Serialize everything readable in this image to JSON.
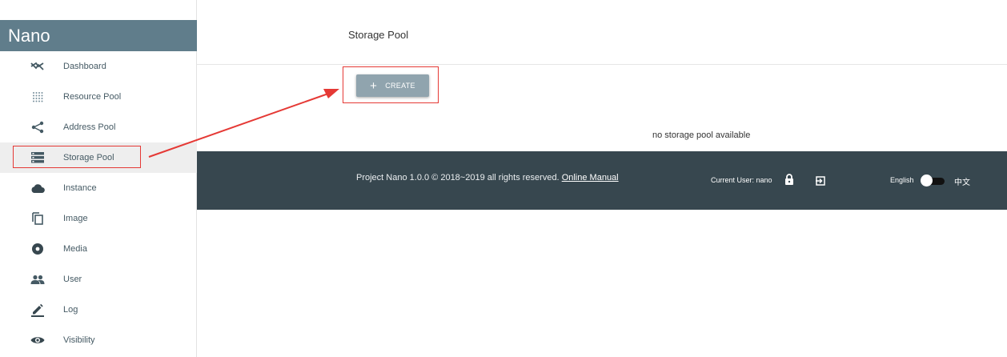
{
  "app": {
    "brand": "Nano"
  },
  "sidebar": {
    "items": [
      {
        "label": "Dashboard",
        "icon": "trending-down-icon"
      },
      {
        "label": "Resource Pool",
        "icon": "dots-grid-icon"
      },
      {
        "label": "Address Pool",
        "icon": "share-icon"
      },
      {
        "label": "Storage Pool",
        "icon": "storage-icon",
        "active": true
      },
      {
        "label": "Instance",
        "icon": "cloud-icon"
      },
      {
        "label": "Image",
        "icon": "copy-icon"
      },
      {
        "label": "Media",
        "icon": "disc-icon"
      },
      {
        "label": "User",
        "icon": "people-icon"
      },
      {
        "label": "Log",
        "icon": "edit-icon"
      },
      {
        "label": "Visibility",
        "icon": "eye-icon"
      }
    ]
  },
  "main": {
    "title": "Storage Pool",
    "create_label": "CREATE",
    "create_icon": "+",
    "empty_message": "no storage pool available"
  },
  "footer": {
    "copyright": "Project Nano 1.0.0 © 2018~2019 all rights reserved.",
    "manual_link": "Online Manual",
    "current_user_label": "Current User: nano",
    "lang_english": "English",
    "lang_chinese": "中文"
  },
  "colors": {
    "brand_bg": "#607d8b",
    "footer_bg": "#37474f",
    "button_bg": "#90a4ae",
    "annotation": "#e53935"
  }
}
